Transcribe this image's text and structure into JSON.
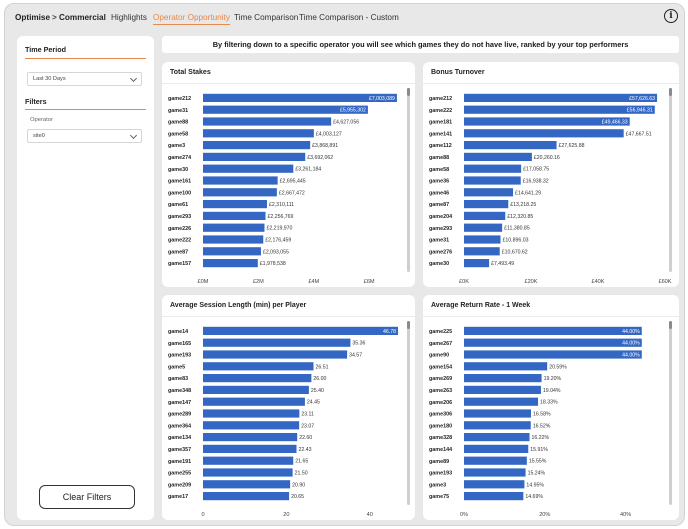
{
  "nav": {
    "items": [
      {
        "label": "Optimise",
        "style": "bold"
      },
      {
        "label": "Commercial",
        "style": "bold"
      },
      {
        "label": "Highlights",
        "style": "normal"
      },
      {
        "label": "Operator Opportunity",
        "style": "active"
      },
      {
        "label": "Time Comparison",
        "style": "normal"
      },
      {
        "label": "Time Comparison - Custom",
        "style": "normal"
      }
    ],
    "separator": ">",
    "active_color": "#e8884a",
    "info_icon": "info-icon"
  },
  "sidebar": {
    "time_period_heading": "Time Period",
    "time_period_value": "Last 30 Days",
    "filters_heading": "Filters",
    "operator_label": "Operator",
    "operator_value": "site0",
    "clear_button_label": "Clear Filters"
  },
  "banner": {
    "text": "By filtering down to a specific operator you will see which games they do not have live, ranked by your top performers"
  },
  "colors": {
    "bar": "#3467c4",
    "accent": "#e8884a"
  },
  "chart_data": [
    {
      "type": "bar",
      "orientation": "horizontal",
      "title": "Total Stakes",
      "categories": [
        "game212",
        "game31",
        "game88",
        "game58",
        "game3",
        "game274",
        "game30",
        "game161",
        "game100",
        "game61",
        "game293",
        "game226",
        "game222",
        "game87",
        "game157"
      ],
      "values": [
        7003089,
        5955302,
        4627056,
        4003127,
        3868891,
        3692062,
        3261184,
        2695445,
        2667472,
        2310111,
        2256769,
        2219970,
        2176459,
        2093055,
        1978538
      ],
      "labels": [
        "£7,003,089",
        "£5,955,302",
        "£4,627,056",
        "£4,003,127",
        "£3,868,891",
        "£3,692,062",
        "£3,261,184",
        "£2,695,445",
        "£2,667,472",
        "£2,310,111",
        "£2,256,769",
        "£2,219,970",
        "£2,176,459",
        "£2,093,055",
        "£1,978,538"
      ],
      "xticks": [
        0,
        2000000,
        4000000,
        6000000
      ],
      "xtick_labels": [
        "£0M",
        "£2M",
        "£4M",
        "£6M"
      ],
      "xlim": [
        0,
        7150000
      ],
      "grid": false
    },
    {
      "type": "bar",
      "orientation": "horizontal",
      "title": "Bonus Turnover",
      "categories": [
        "game212",
        "game222",
        "game181",
        "game141",
        "game112",
        "game88",
        "game58",
        "game36",
        "game46",
        "game87",
        "game204",
        "game293",
        "game31",
        "game276",
        "game30"
      ],
      "values": [
        57626.63,
        56946.31,
        49466.33,
        47667.51,
        27625.88,
        20260.16,
        17058.75,
        16938.32,
        14641.29,
        13218.25,
        12320.85,
        11380.85,
        10896.03,
        10670.62,
        7493.49
      ],
      "labels": [
        "£57,626.63",
        "£56,946.31",
        "£49,466.33",
        "£47,667.51",
        "£27,625.88",
        "£20,260.16",
        "£17,058.75",
        "£16,938.32",
        "£14,641.29",
        "£13,218.25",
        "£12,320.85",
        "£11,380.85",
        "£10,896.03",
        "£10,670.62",
        "£7,493.49"
      ],
      "xticks": [
        0,
        20000,
        40000,
        60000
      ],
      "xtick_labels": [
        "£0K",
        "£20K",
        "£40K",
        "£60K"
      ],
      "xlim": [
        0,
        60000
      ],
      "grid": false
    },
    {
      "type": "bar",
      "orientation": "horizontal",
      "title": "Average Session Length (min) per Player",
      "categories": [
        "game14",
        "game165",
        "game193",
        "game5",
        "game83",
        "game348",
        "game147",
        "game289",
        "game364",
        "game134",
        "game357",
        "game191",
        "game255",
        "game209",
        "game17"
      ],
      "values": [
        46.78,
        35.36,
        34.57,
        26.51,
        26.0,
        25.4,
        24.45,
        23.11,
        23.07,
        22.6,
        22.43,
        21.65,
        21.5,
        20.9,
        20.65
      ],
      "labels": [
        "46.78",
        "35.36",
        "34.57",
        "26.51",
        "26.00",
        "25.40",
        "24.45",
        "23.11",
        "23.07",
        "22.60",
        "22.43",
        "21.65",
        "21.50",
        "20.90",
        "20.65"
      ],
      "xticks": [
        0,
        20,
        40
      ],
      "xtick_labels": [
        "0",
        "20",
        "40"
      ],
      "xlim": [
        0,
        47.5
      ],
      "grid": false
    },
    {
      "type": "bar",
      "orientation": "horizontal",
      "title": "Average Return Rate - 1 Week",
      "categories": [
        "game225",
        "game267",
        "game90",
        "game154",
        "game269",
        "game263",
        "game206",
        "game306",
        "game180",
        "game328",
        "game144",
        "game89",
        "game193",
        "game3",
        "game75"
      ],
      "values": [
        44.0,
        44.0,
        44.0,
        20.59,
        19.2,
        19.04,
        18.33,
        16.58,
        16.52,
        16.22,
        15.91,
        15.55,
        15.24,
        14.95,
        14.69
      ],
      "labels": [
        "44.00%",
        "44.00%",
        "44.00%",
        "20.59%",
        "19.20%",
        "19.04%",
        "18.33%",
        "16.58%",
        "16.52%",
        "16.22%",
        "15.91%",
        "15.55%",
        "15.24%",
        "14.95%",
        "14.69%"
      ],
      "xticks": [
        0,
        20,
        40
      ],
      "xtick_labels": [
        "0%",
        "20%",
        "40%"
      ],
      "xlim": [
        0,
        49.75
      ],
      "grid": false
    }
  ]
}
